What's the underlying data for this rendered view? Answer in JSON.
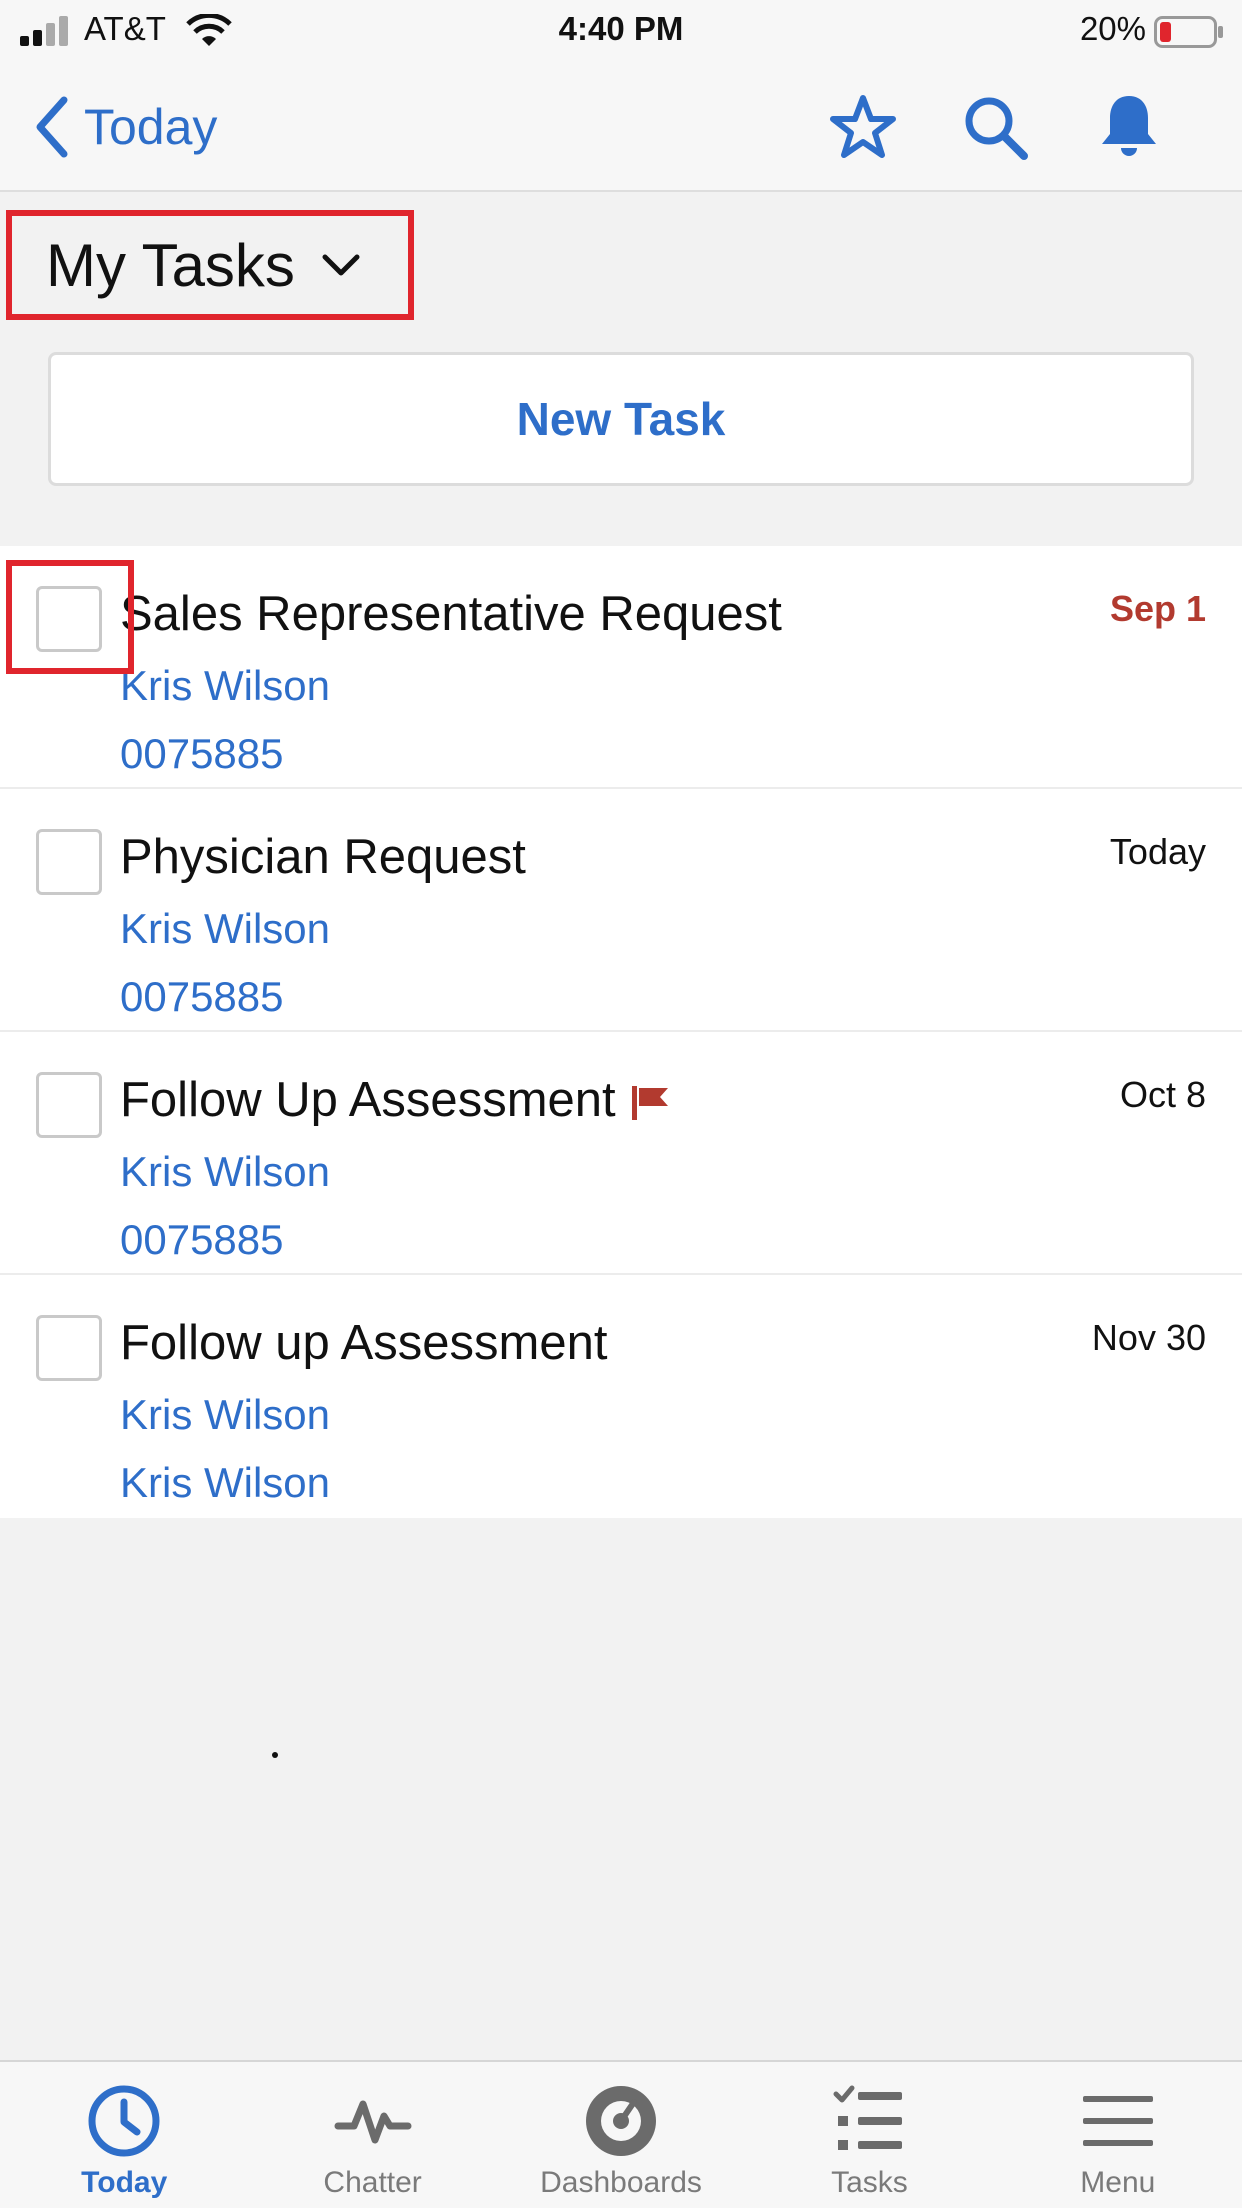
{
  "status_bar": {
    "carrier": "AT&T",
    "time": "4:40 PM",
    "battery_percent": "20%"
  },
  "nav": {
    "back_label": "Today",
    "icons": [
      "star-icon",
      "search-icon",
      "bell-icon"
    ]
  },
  "list_view": {
    "title": "My Tasks"
  },
  "new_task_label": "New Task",
  "tasks": [
    {
      "title": "Sales Representative Request",
      "line1": "Kris Wilson",
      "line2": "0075885",
      "date": "Sep 1",
      "overdue": true,
      "flagged": false
    },
    {
      "title": "Physician Request",
      "line1": "Kris Wilson",
      "line2": "0075885",
      "date": "Today",
      "overdue": false,
      "flagged": false
    },
    {
      "title": "Follow Up Assessment",
      "line1": "Kris Wilson",
      "line2": "0075885",
      "date": "Oct 8",
      "overdue": false,
      "flagged": true
    },
    {
      "title": "Follow up Assessment",
      "line1": "Kris Wilson",
      "line2": "Kris Wilson",
      "date": "Nov 30",
      "overdue": false,
      "flagged": false
    }
  ],
  "tab_bar": {
    "tabs": [
      {
        "label": "Today",
        "icon": "clock-icon",
        "active": true
      },
      {
        "label": "Chatter",
        "icon": "pulse-icon",
        "active": false
      },
      {
        "label": "Dashboards",
        "icon": "gauge-icon",
        "active": false
      },
      {
        "label": "Tasks",
        "icon": "checklist-icon",
        "active": false
      },
      {
        "label": "Menu",
        "icon": "hamburger-icon",
        "active": false
      }
    ]
  },
  "colors": {
    "accent": "#2e6ec9",
    "overdue": "#b23a2f",
    "highlight": "#e0252d"
  }
}
